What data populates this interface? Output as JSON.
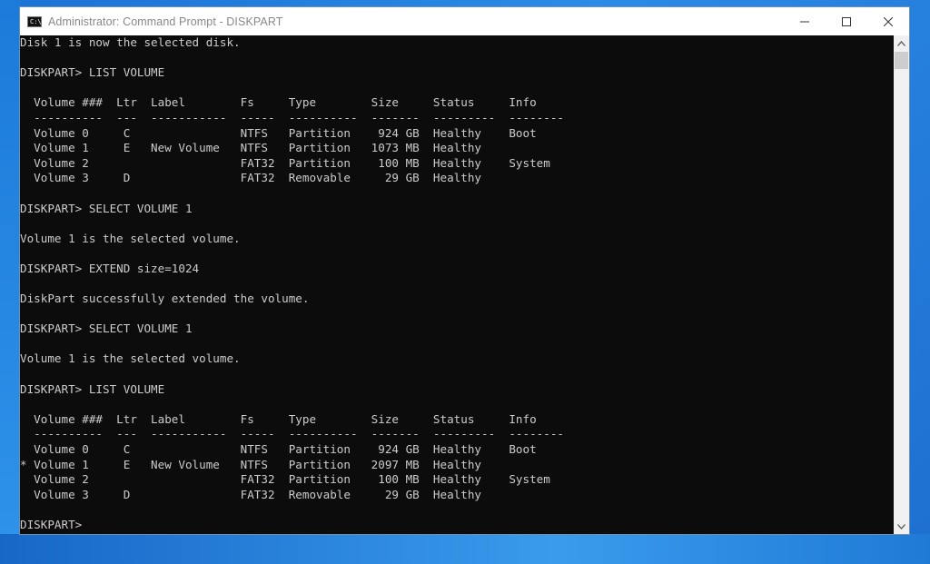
{
  "window": {
    "title": "Administrator: Command Prompt - DISKPART",
    "icon": "cmd-icon",
    "icon_text": "C:\\",
    "controls": [
      "minimize-icon",
      "maximize-icon",
      "close-icon"
    ]
  },
  "console": {
    "lines": [
      "Disk 1 is now the selected disk.",
      "",
      "DISKPART> LIST VOLUME",
      "",
      "  Volume ###  Ltr  Label        Fs     Type        Size     Status     Info",
      "  ----------  ---  -----------  -----  ----------  -------  ---------  --------",
      "  Volume 0     C                NTFS   Partition    924 GB  Healthy    Boot",
      "  Volume 1     E   New Volume   NTFS   Partition   1073 MB  Healthy",
      "  Volume 2                      FAT32  Partition    100 MB  Healthy    System",
      "  Volume 3     D                FAT32  Removable     29 GB  Healthy",
      "",
      "DISKPART> SELECT VOLUME 1",
      "",
      "Volume 1 is the selected volume.",
      "",
      "DISKPART> EXTEND size=1024",
      "",
      "DiskPart successfully extended the volume.",
      "",
      "DISKPART> SELECT VOLUME 1",
      "",
      "Volume 1 is the selected volume.",
      "",
      "DISKPART> LIST VOLUME",
      "",
      "  Volume ###  Ltr  Label        Fs     Type        Size     Status     Info",
      "  ----------  ---  -----------  -----  ----------  -------  ---------  --------",
      "  Volume 0     C                NTFS   Partition    924 GB  Healthy    Boot",
      "* Volume 1     E   New Volume   NTFS   Partition   2097 MB  Healthy",
      "  Volume 2                      FAT32  Partition    100 MB  Healthy    System",
      "  Volume 3     D                FAT32  Removable     29 GB  Healthy",
      "",
      "DISKPART> "
    ]
  },
  "colors": {
    "console_bg": "#0c0c0c",
    "console_text": "#cccccc",
    "titlebar_bg": "#ffffff",
    "title_text": "#888888",
    "desktop": "#1a73d6"
  }
}
